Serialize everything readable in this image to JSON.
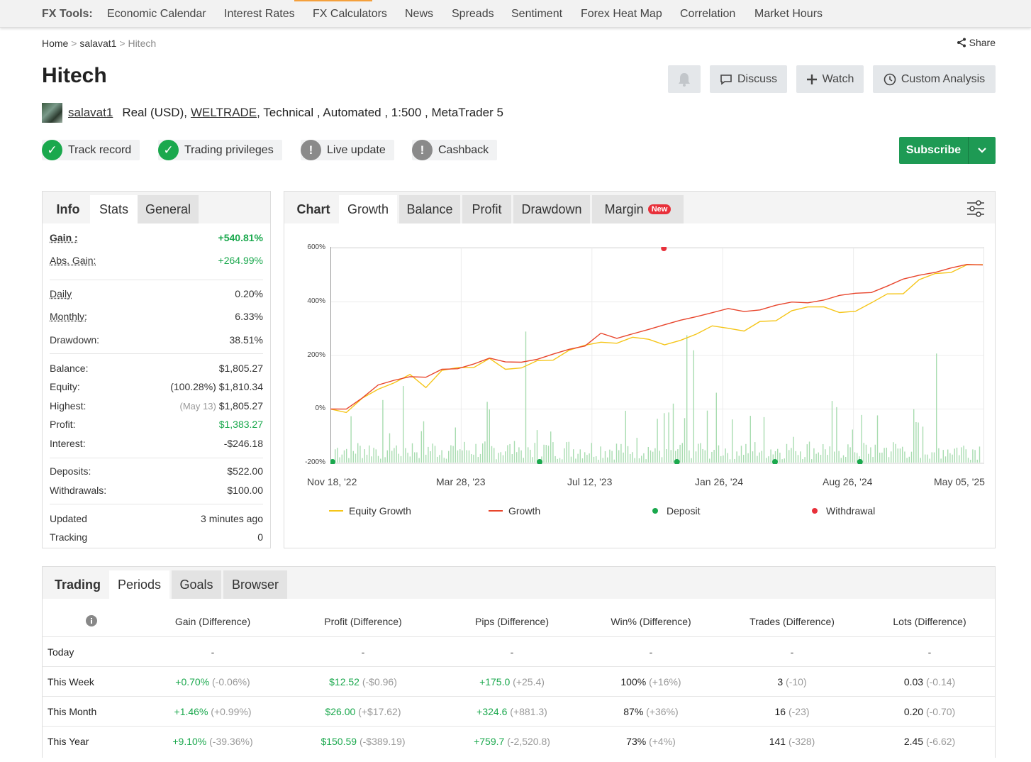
{
  "nav": {
    "label": "FX Tools:",
    "items": [
      "Economic Calendar",
      "Interest Rates",
      "FX Calculators",
      "News",
      "Spreads",
      "Sentiment",
      "Forex Heat Map",
      "Correlation",
      "Market Hours"
    ]
  },
  "breadcrumb": {
    "home": "Home",
    "user": "salavat1",
    "current": "Hitech"
  },
  "share_label": "Share",
  "title": "Hitech",
  "header_buttons": {
    "discuss": "Discuss",
    "watch": "Watch",
    "custom": "Custom Analysis"
  },
  "meta": {
    "user": "salavat1",
    "account": "Real (USD),",
    "broker": "WELTRADE",
    "details": ", Technical , Automated , 1:500 , MetaTrader 5"
  },
  "badges": [
    "Track record",
    "Trading privileges",
    "Live update",
    "Cashback"
  ],
  "subscribe_label": "Subscribe",
  "stats_tabs": [
    "Info",
    "Stats",
    "General"
  ],
  "stats": {
    "gain_label": "Gain :",
    "gain": "+540.81%",
    "abs_gain_label": "Abs. Gain:",
    "abs_gain": "+264.99%",
    "daily_label": "Daily",
    "daily": "0.20%",
    "monthly_label": "Monthly:",
    "monthly": "6.33%",
    "drawdown_label": "Drawdown:",
    "drawdown": "38.51%",
    "balance_label": "Balance:",
    "balance": "$1,805.27",
    "equity_label": "Equity:",
    "equity_pct": "(100.28%)",
    "equity": "$1,810.34",
    "highest_label": "Highest:",
    "highest_date": "(May 13)",
    "highest": "$1,805.27",
    "profit_label": "Profit:",
    "profit": "$1,383.27",
    "interest_label": "Interest:",
    "interest": "-$246.18",
    "deposits_label": "Deposits:",
    "deposits": "$522.00",
    "withdrawals_label": "Withdrawals:",
    "withdrawals": "$100.00",
    "updated_label": "Updated",
    "updated": "3 minutes ago",
    "tracking_label": "Tracking",
    "tracking": "0"
  },
  "chart_tabs": [
    "Chart",
    "Growth",
    "Balance",
    "Profit",
    "Drawdown",
    "Margin"
  ],
  "new_badge": "New",
  "chart_data": {
    "type": "line",
    "x_ticks": [
      "Nov 18, '22",
      "Mar 28, '23",
      "Jul 12, '23",
      "Jan 26, '24",
      "Aug 26, '24",
      "May 05, '25"
    ],
    "y_ticks": [
      "600%",
      "400%",
      "200%",
      "0%",
      "-200%"
    ],
    "ylim": [
      -200,
      600
    ],
    "series": [
      {
        "name": "Equity Growth",
        "color": "#f5c518",
        "values": [
          0,
          -5,
          30,
          80,
          100,
          120,
          90,
          140,
          150,
          165,
          180,
          150,
          160,
          170,
          190,
          220,
          230,
          260,
          240,
          265,
          270,
          230,
          260,
          285,
          300,
          310,
          290,
          320,
          340,
          360,
          380,
          390,
          350,
          370,
          400,
          420,
          440,
          480,
          500,
          520,
          530,
          540
        ]
      },
      {
        "name": "Growth",
        "color": "#e8452c",
        "values": [
          0,
          5,
          40,
          85,
          110,
          125,
          115,
          145,
          155,
          170,
          185,
          175,
          180,
          185,
          200,
          225,
          240,
          280,
          260,
          285,
          300,
          310,
          330,
          350,
          360,
          370,
          365,
          375,
          385,
          395,
          400,
          410,
          420,
          430,
          440,
          460,
          480,
          500,
          515,
          525,
          535,
          541
        ]
      }
    ],
    "legend": [
      "Equity Growth",
      "Growth",
      "Deposit",
      "Withdrawal"
    ],
    "legend_colors": {
      "equity": "#f5c518",
      "growth": "#e8452c",
      "deposit": "#1aa84d",
      "withdrawal": "#e8303a"
    },
    "deposit_markers": [
      0,
      0.32,
      0.53,
      0.68,
      0.81
    ],
    "withdrawal_markers": [
      0.51
    ]
  },
  "bottom_tabs": [
    "Trading",
    "Periods",
    "Goals",
    "Browser"
  ],
  "periods": {
    "headers": [
      "Gain (Difference)",
      "Profit (Difference)",
      "Pips (Difference)",
      "Win% (Difference)",
      "Trades (Difference)",
      "Lots (Difference)"
    ],
    "rows": [
      {
        "name": "Today",
        "cells": [
          [
            "-",
            ""
          ],
          [
            "-",
            ""
          ],
          [
            "-",
            ""
          ],
          [
            "-",
            ""
          ],
          [
            "-",
            ""
          ],
          [
            "-",
            ""
          ]
        ]
      },
      {
        "name": "This Week",
        "cells": [
          [
            "+0.70%",
            "(-0.06%)"
          ],
          [
            "$12.52",
            "(-$0.96)"
          ],
          [
            "+175.0",
            "(+25.4)"
          ],
          [
            "100%",
            "(+16%)"
          ],
          [
            "3",
            "(-10)"
          ],
          [
            "0.03",
            "(-0.14)"
          ]
        ]
      },
      {
        "name": "This Month",
        "cells": [
          [
            "+1.46%",
            "(+0.99%)"
          ],
          [
            "$26.00",
            "(+$17.62)"
          ],
          [
            "+324.6",
            "(+881.3)"
          ],
          [
            "87%",
            "(+36%)"
          ],
          [
            "16",
            "(-23)"
          ],
          [
            "0.20",
            "(-0.70)"
          ]
        ]
      },
      {
        "name": "This Year",
        "cells": [
          [
            "+9.10%",
            "(-39.36%)"
          ],
          [
            "$150.59",
            "(-$389.19)"
          ],
          [
            "+759.7",
            "(-2,520.8)"
          ],
          [
            "73%",
            "(+4%)"
          ],
          [
            "141",
            "(-328)"
          ],
          [
            "2.45",
            "(-6.62)"
          ]
        ]
      }
    ]
  }
}
